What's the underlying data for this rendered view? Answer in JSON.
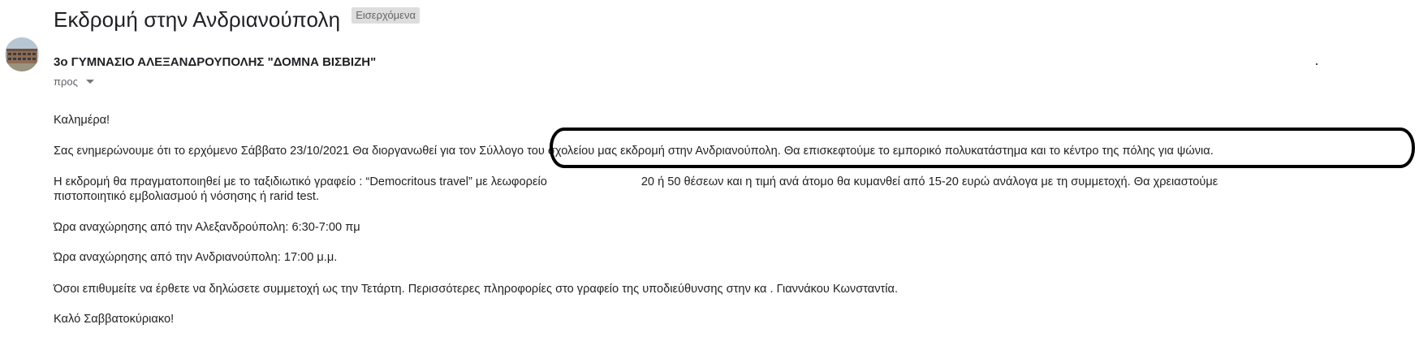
{
  "email": {
    "subject": "Εκδρομή στην Ανδριανούπολη",
    "label": "Εισερχόμενα",
    "sender_name": "3ο ΓΥΜΝΑΣΙΟ ΑΛΕΞΑΝΔΡΟΥΠΟΛΗΣ \"ΔΟΜΝΑ ΒΙΣΒΙΖΗ\"",
    "recipients_label": "προς",
    "avatar_icon": "school-building-avatar"
  },
  "body": {
    "greeting": "Καλημέρα!",
    "intro": "Σας ενημερώνουμε ότι το ερχόμενο Σάββατο 23/10/2021 Θα διοργανωθεί για τον Σύλλογο του σχολείου μας εκδρομή στην Ανδριανούπολη. Θα επισκεφτούμε το εμπορικό πολυκατάστημα και το κέντρο της πόλης για ψώνια.",
    "travel_part1": "Η εκδρομή θα πραγματοποιηθεί με το ταξιδιωτικό γραφείο : “Democritous travel” με λεωφορείο",
    "travel_part2": "20 ή 50 θέσεων και η τιμή ανά άτομο θα κυμανθεί από 15-20 ευρώ ανάλογα με τη συμμετοχή. Θα χρειαστούμε",
    "travel_line2": "πιστοποιητικό εμβολιασμού ή νόσησης ή rarid test.",
    "departure_1": "Ώρα αναχώρησης από την Αλεξανδρούπολη: 6:30-7:00 πμ",
    "departure_2": "Ώρα αναχώρησης από την Ανδριανούπολη: 17:00 μ.μ.",
    "info": "Όσοι επιθυμείτε να έρθετε να δηλώσετε συμμετοχή ως την Τετάρτη. Περισσότερες πληροφορίες στο γραφείο της υποδιεύθυνσης στην κα . Γιαννάκου Κωνσταντία.",
    "closing": "Καλό Σαββατοκύριακο!"
  },
  "annotation": {
    "shape": "hand-drawn oval",
    "color": "#000000"
  }
}
